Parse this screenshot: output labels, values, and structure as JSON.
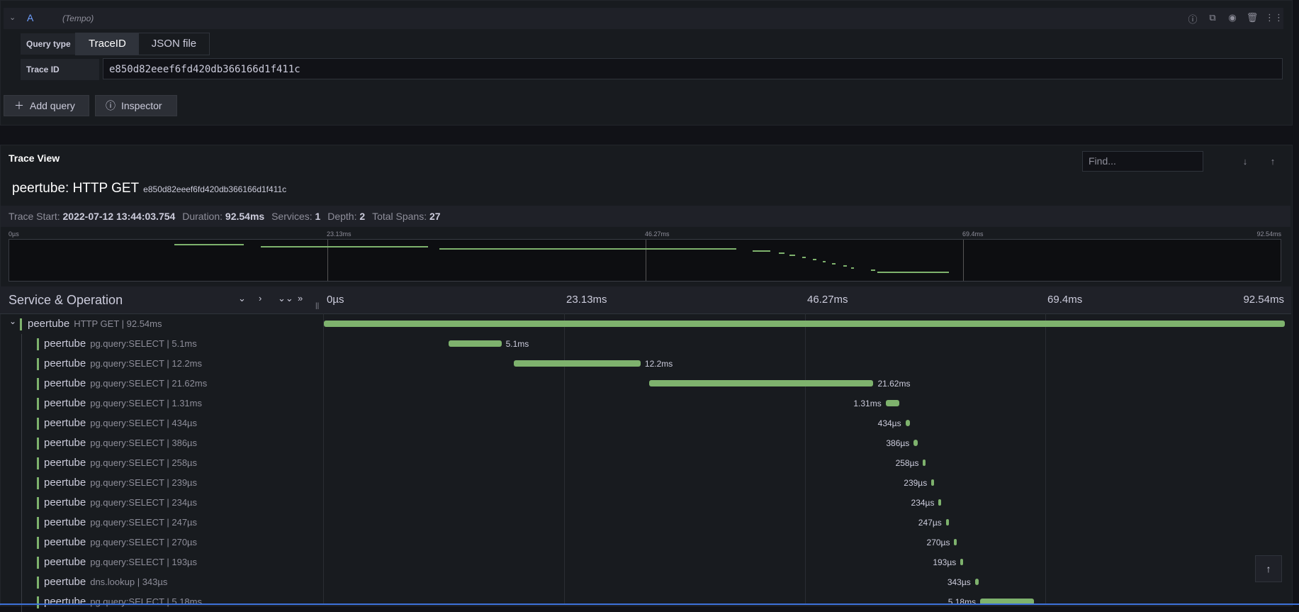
{
  "query": {
    "ref_id": "A",
    "datasource": "(Tempo)",
    "query_type_label": "Query type",
    "query_types": [
      "TraceID",
      "JSON file"
    ],
    "trace_id_label": "Trace ID",
    "trace_id_value": "e850d82eeef6fd420db366166d1f411c",
    "add_query": "Add query",
    "inspector": "Inspector"
  },
  "trace": {
    "panel_title": "Trace View",
    "find_placeholder": "Find...",
    "title": "peertube: HTTP GET",
    "trace_id": "e850d82eeef6fd420db366166d1f411c",
    "stats": {
      "start_label": "Trace Start:",
      "start": "2022-07-12 13:44:03.754",
      "duration_label": "Duration:",
      "duration": "92.54ms",
      "services_label": "Services:",
      "services": "1",
      "depth_label": "Depth:",
      "depth": "2",
      "spans_label": "Total Spans:",
      "spans": "27"
    },
    "minimap_ticks": [
      "0µs",
      "23.13ms",
      "46.27ms",
      "69.4ms",
      "92.54ms"
    ],
    "header_label": "Service & Operation",
    "ticks": [
      "0µs",
      "23.13ms",
      "46.27ms",
      "69.4ms",
      "92.54ms"
    ],
    "total_ms": 92.54,
    "spans": [
      {
        "service": "peertube",
        "op": "HTTP GET | 92.54ms",
        "start_ms": 0,
        "dur_ms": 92.54,
        "label": "",
        "root": true
      },
      {
        "service": "peertube",
        "op": "pg.query:SELECT | 5.1ms",
        "start_ms": 12.0,
        "dur_ms": 5.1,
        "label": "5.1ms"
      },
      {
        "service": "peertube",
        "op": "pg.query:SELECT | 12.2ms",
        "start_ms": 18.3,
        "dur_ms": 12.2,
        "label": "12.2ms"
      },
      {
        "service": "peertube",
        "op": "pg.query:SELECT | 21.62ms",
        "start_ms": 31.3,
        "dur_ms": 21.62,
        "label": "21.62ms"
      },
      {
        "service": "peertube",
        "op": "pg.query:SELECT | 1.31ms",
        "start_ms": 54.1,
        "dur_ms": 1.31,
        "label": "1.31ms",
        "left": true
      },
      {
        "service": "peertube",
        "op": "pg.query:SELECT | 434µs",
        "start_ms": 56.0,
        "dur_ms": 0.434,
        "label": "434µs",
        "left": true
      },
      {
        "service": "peertube",
        "op": "pg.query:SELECT | 386µs",
        "start_ms": 56.8,
        "dur_ms": 0.386,
        "label": "386µs",
        "left": true
      },
      {
        "service": "peertube",
        "op": "pg.query:SELECT | 258µs",
        "start_ms": 57.7,
        "dur_ms": 0.258,
        "label": "258µs",
        "left": true
      },
      {
        "service": "peertube",
        "op": "pg.query:SELECT | 239µs",
        "start_ms": 58.5,
        "dur_ms": 0.239,
        "label": "239µs",
        "left": true
      },
      {
        "service": "peertube",
        "op": "pg.query:SELECT | 234µs",
        "start_ms": 59.2,
        "dur_ms": 0.234,
        "label": "234µs",
        "left": true
      },
      {
        "service": "peertube",
        "op": "pg.query:SELECT | 247µs",
        "start_ms": 59.9,
        "dur_ms": 0.247,
        "label": "247µs",
        "left": true
      },
      {
        "service": "peertube",
        "op": "pg.query:SELECT | 270µs",
        "start_ms": 60.7,
        "dur_ms": 0.27,
        "label": "270µs",
        "left": true
      },
      {
        "service": "peertube",
        "op": "pg.query:SELECT | 193µs",
        "start_ms": 61.3,
        "dur_ms": 0.193,
        "label": "193µs",
        "left": true
      },
      {
        "service": "peertube",
        "op": "dns.lookup | 343µs",
        "start_ms": 62.7,
        "dur_ms": 0.343,
        "label": "343µs",
        "left": true
      },
      {
        "service": "peertube",
        "op": "pg.query:SELECT | 5.18ms",
        "start_ms": 63.2,
        "dur_ms": 5.18,
        "label": "5.18ms",
        "left": true
      }
    ]
  },
  "colors": {
    "span": "#7eb26d",
    "accent": "#6e9fff"
  }
}
